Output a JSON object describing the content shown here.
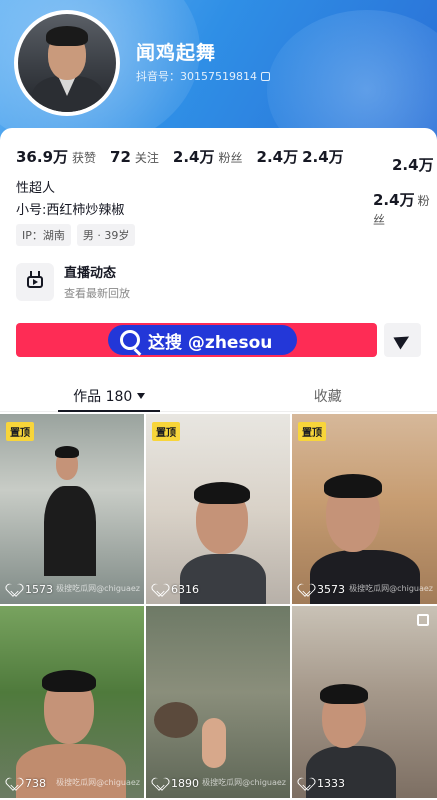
{
  "profile": {
    "nickname": "闻鸡起舞",
    "douyin_id": "抖音号：30157519814"
  },
  "stats": [
    {
      "value": "36.9万",
      "label": "获赞"
    },
    {
      "value": "72",
      "label": "关注"
    },
    {
      "value": "2.4万",
      "label": "粉丝"
    },
    {
      "value": "2.4万",
      "label": ""
    },
    {
      "value": "2.4万",
      "label": ""
    }
  ],
  "stats_overlay": {
    "value_a": "2.4万",
    "value_b": "2.4万",
    "label_b": "粉丝"
  },
  "bio": {
    "line1": "性超人",
    "line2": "小号:西红柿炒辣椒"
  },
  "tags": [
    "IP：湖南",
    "男 · 39岁"
  ],
  "live": {
    "title": "直播动态",
    "subtitle": "查看最新回放"
  },
  "watermark_banner": "这搜 @zhesou",
  "tabs": [
    {
      "label": "作品 180"
    },
    {
      "label": "收藏"
    }
  ],
  "videos": [
    {
      "pinned": "置顶",
      "likes": "1573",
      "watermark": "极搜吃瓜网@chiguaez"
    },
    {
      "pinned": "置顶",
      "likes": "6316",
      "watermark": ""
    },
    {
      "pinned": "置顶",
      "likes": "3573",
      "watermark": "极搜吃瓜网@chiguaez"
    },
    {
      "pinned": "",
      "likes": "738",
      "watermark": "极搜吃瓜网@chiguaez"
    },
    {
      "pinned": "",
      "likes": "1890",
      "watermark": "极搜吃瓜网@chiguaez"
    },
    {
      "pinned": "",
      "likes": "1333",
      "watermark": ""
    }
  ],
  "colors": {
    "banner": "#2f8fe6",
    "follow_button": "#fe2c55",
    "watermark_pill": "#2337d8",
    "pin_badge": "#f8d53a"
  }
}
